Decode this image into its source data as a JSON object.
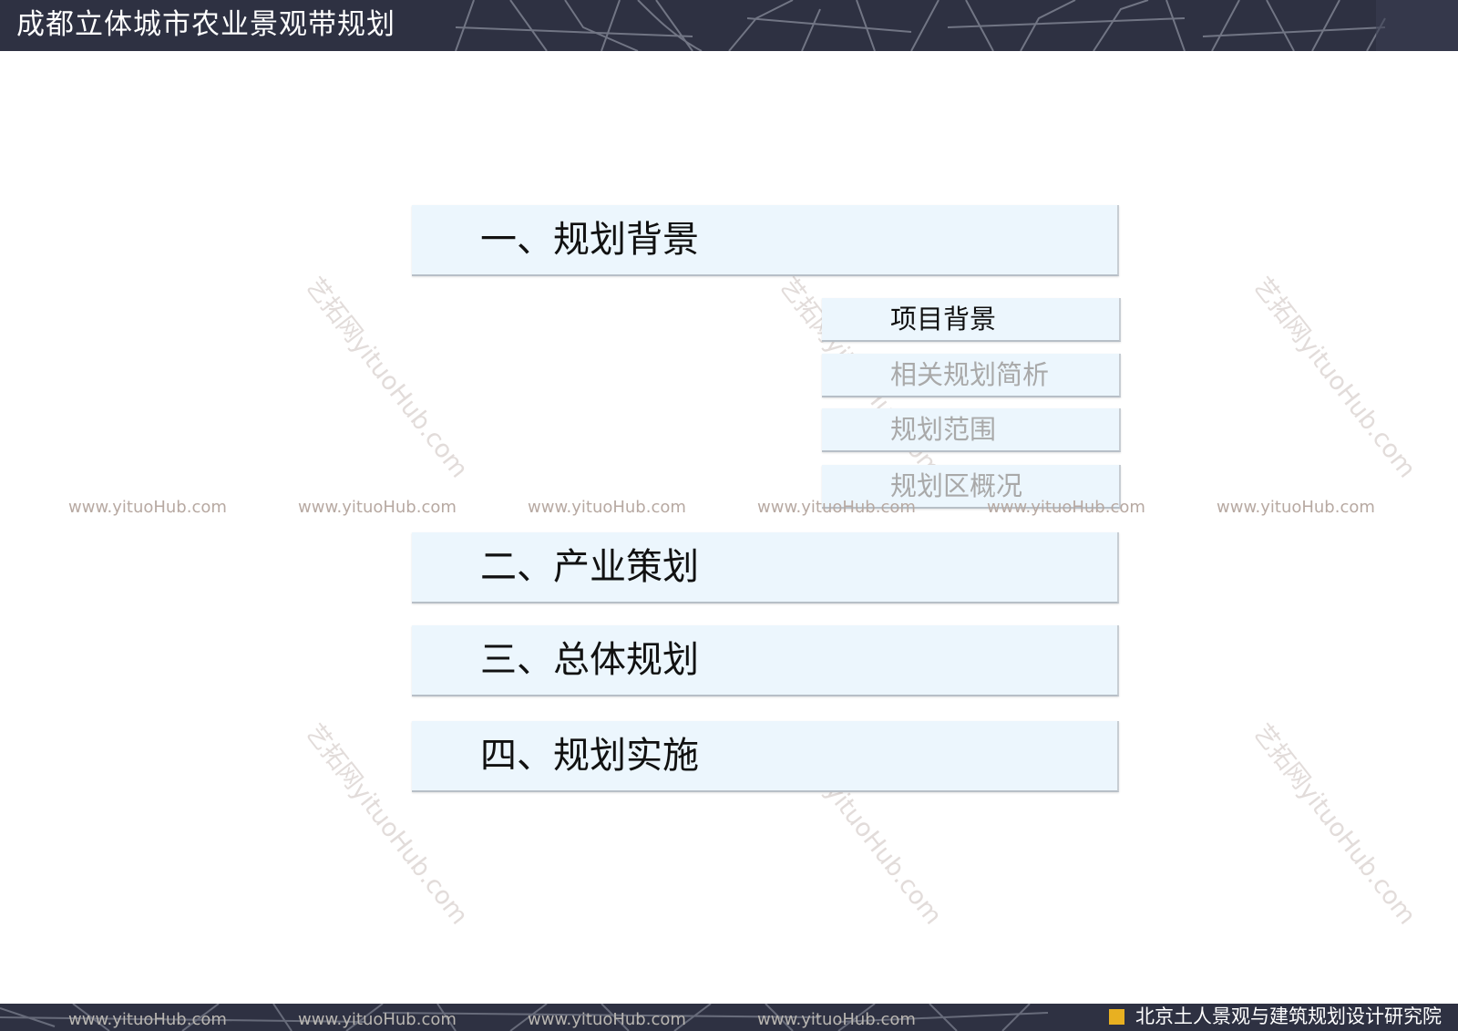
{
  "header": {
    "title": "成都立体城市农业景观带规划"
  },
  "sections": [
    {
      "label": "一、规划背景"
    },
    {
      "label": "二、产业策划"
    },
    {
      "label": "三、总体规划"
    },
    {
      "label": "四、规划实施"
    }
  ],
  "subsections": [
    {
      "label": "项目背景",
      "active": true
    },
    {
      "label": "相关规划简析",
      "active": false
    },
    {
      "label": "规划范围",
      "active": false
    },
    {
      "label": "规划区概况",
      "active": false
    }
  ],
  "watermark": {
    "url_text": "www.yituoHub.com",
    "diagonal_text": "艺拓网yituoHub.com"
  },
  "footer": {
    "organization": "北京土人景观与建筑规划设计研究院"
  },
  "colors": {
    "bar_background": "#2e3142",
    "box_background": "#ecf6fd",
    "logo_accent": "#e8b021"
  }
}
